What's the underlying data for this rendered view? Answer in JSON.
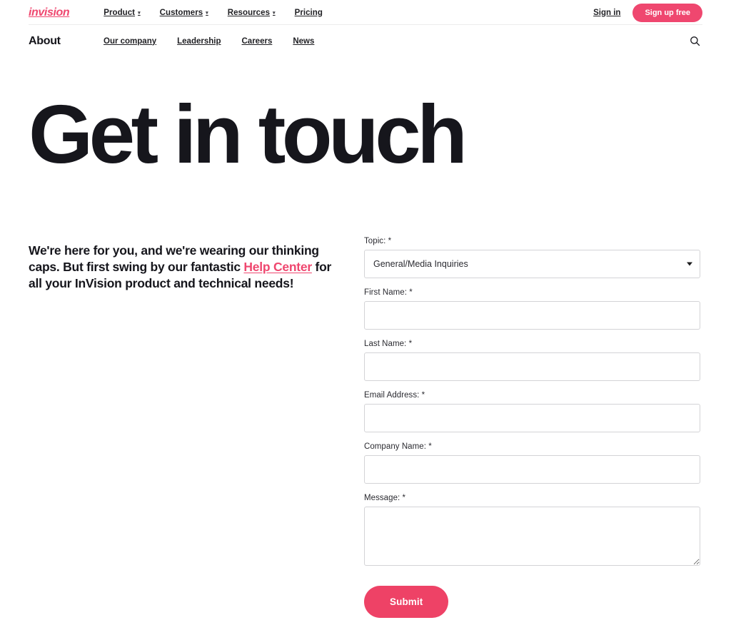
{
  "brand": {
    "logo_text": "invision",
    "accent_color": "#ef476f",
    "submit_color": "#ee4266"
  },
  "topnav": {
    "links": [
      {
        "label": "Product",
        "has_caret": true
      },
      {
        "label": "Customers",
        "has_caret": true
      },
      {
        "label": "Resources",
        "has_caret": true
      },
      {
        "label": "Pricing",
        "has_caret": false
      }
    ],
    "caret_glyph": "▾",
    "signin_label": "Sign in",
    "signup_label": "Sign up free"
  },
  "subnav": {
    "title": "About",
    "links": [
      {
        "label": "Our company"
      },
      {
        "label": "Leadership"
      },
      {
        "label": "Careers"
      },
      {
        "label": "News"
      }
    ],
    "search_icon": "search-icon"
  },
  "hero": {
    "title": "Get in touch"
  },
  "intro": {
    "part1": "We're here for you, and we're wearing our thinking caps. But first swing by our fantastic ",
    "link_text": "Help Center",
    "part2": " for all your InVision product and technical needs!"
  },
  "form": {
    "topic": {
      "label": "Topic:",
      "required_mark": "*",
      "value": "General/Media Inquiries",
      "options": [
        "General/Media Inquiries"
      ]
    },
    "first_name": {
      "label": "First Name:",
      "required_mark": "*",
      "value": "",
      "placeholder": ""
    },
    "last_name": {
      "label": "Last Name:",
      "required_mark": "*",
      "value": "",
      "placeholder": ""
    },
    "email": {
      "label": "Email Address:",
      "required_mark": "*",
      "value": "",
      "placeholder": ""
    },
    "company": {
      "label": "Company Name:",
      "required_mark": "*",
      "value": "",
      "placeholder": ""
    },
    "message": {
      "label": "Message:",
      "required_mark": "*",
      "value": "",
      "placeholder": ""
    },
    "submit_label": "Submit"
  }
}
